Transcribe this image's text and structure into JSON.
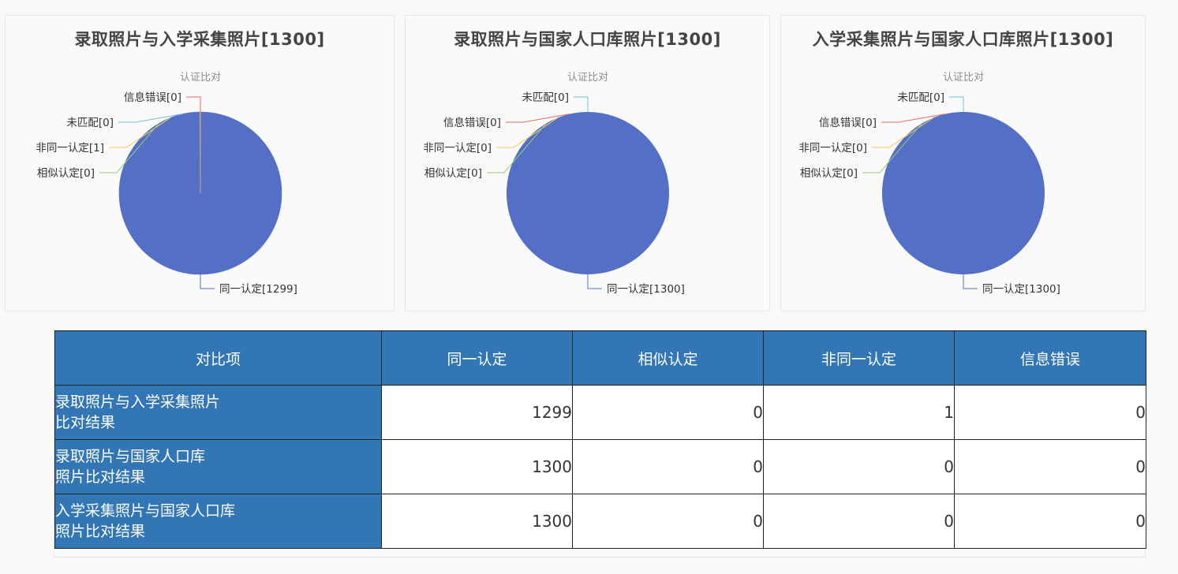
{
  "charts": [
    {
      "title": "录取照片与入学采集照片[1300]",
      "subtitle": "认证比对"
    },
    {
      "title": "录取照片与国家人口库照片[1300]",
      "subtitle": "认证比对"
    },
    {
      "title": "入学采集照片与国家人口库照片[1300]",
      "subtitle": "认证比对"
    }
  ],
  "chart_data": [
    {
      "type": "pie",
      "title": "录取照片与入学采集照片[1300]",
      "subtitle": "认证比对",
      "slices": [
        {
          "label": "同一认定",
          "value": 1299,
          "color": "#5470c6"
        },
        {
          "label": "相似认定",
          "value": 0,
          "color": "#91cc75"
        },
        {
          "label": "非同一认定",
          "value": 1,
          "color": "#fac858"
        },
        {
          "label": "未匹配",
          "value": 0,
          "color": "#73c0de"
        },
        {
          "label": "信息错误",
          "value": 0,
          "color": "#ee6666"
        }
      ]
    },
    {
      "type": "pie",
      "title": "录取照片与国家人口库照片[1300]",
      "subtitle": "认证比对",
      "slices": [
        {
          "label": "同一认定",
          "value": 1300,
          "color": "#5470c6"
        },
        {
          "label": "相似认定",
          "value": 0,
          "color": "#91cc75"
        },
        {
          "label": "非同一认定",
          "value": 0,
          "color": "#fac858"
        },
        {
          "label": "信息错误",
          "value": 0,
          "color": "#ee6666"
        },
        {
          "label": "未匹配",
          "value": 0,
          "color": "#73c0de"
        }
      ]
    },
    {
      "type": "pie",
      "title": "入学采集照片与国家人口库照片[1300]",
      "subtitle": "认证比对",
      "slices": [
        {
          "label": "同一认定",
          "value": 1300,
          "color": "#5470c6"
        },
        {
          "label": "相似认定",
          "value": 0,
          "color": "#91cc75"
        },
        {
          "label": "非同一认定",
          "value": 0,
          "color": "#fac858"
        },
        {
          "label": "信息错误",
          "value": 0,
          "color": "#ee6666"
        },
        {
          "label": "未匹配",
          "value": 0,
          "color": "#73c0de"
        }
      ]
    }
  ],
  "table": {
    "headers": [
      "对比项",
      "同一认定",
      "相似认定",
      "非同一认定",
      "信息错误"
    ],
    "rows": [
      {
        "item": [
          "录取照片与入学采集照片",
          "比对结果"
        ],
        "values": [
          "1299",
          "0",
          "1",
          "0"
        ]
      },
      {
        "item": [
          "录取照片与国家人口库",
          "照片比对结果"
        ],
        "values": [
          "1300",
          "0",
          "0",
          "0"
        ]
      },
      {
        "item": [
          "入学采集照片与国家人口库",
          "照片比对结果"
        ],
        "values": [
          "1300",
          "0",
          "0",
          "0"
        ]
      }
    ]
  },
  "colors": {
    "header_bg": "#3276b6",
    "pie_main": "#5470c6"
  }
}
